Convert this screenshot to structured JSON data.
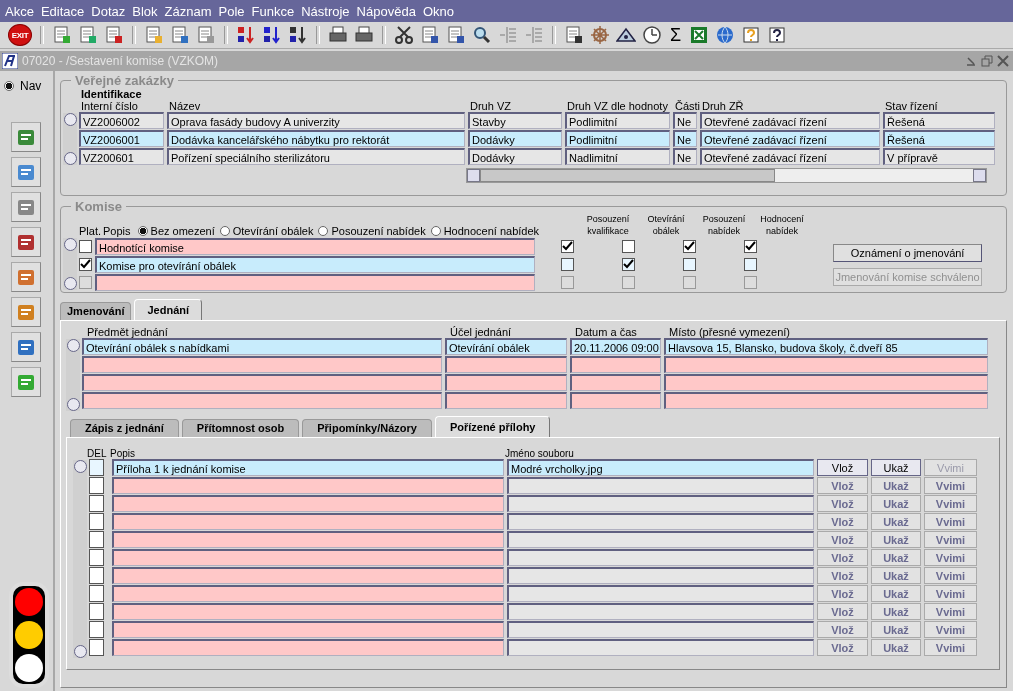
{
  "menu": [
    {
      "label": "Akce"
    },
    {
      "label": "Editace"
    },
    {
      "label": "Dotaz"
    },
    {
      "label": "Blok"
    },
    {
      "label": "Záznam"
    },
    {
      "label": "Pole"
    },
    {
      "label": "Funkce"
    },
    {
      "label": "Nástroje"
    },
    {
      "label": "Nápověda"
    },
    {
      "label": "Okno"
    }
  ],
  "toolbar": {
    "exit_label": "EXIT",
    "sum_glyph": "Σ"
  },
  "window": {
    "title": "07020 - /Sestavení komise (VZKOM)"
  },
  "nav": {
    "label": "Nav",
    "selected": true
  },
  "zakazky": {
    "title": "Veřejné zakázky",
    "group_label": "Identifikace",
    "columns": [
      "Interní číslo",
      "Název",
      "Druh VZ",
      "Druh VZ dle hodnoty",
      "Části",
      "Druh ZŘ",
      "Stav řízení"
    ],
    "rows": [
      {
        "selected": false,
        "cells": [
          "VZ2006002",
          "Oprava fasády budovy A univerzity",
          "Stavby",
          "Podlimitní",
          "Ne",
          "Otevřené zadávací řízení",
          "Řešená"
        ]
      },
      {
        "selected": true,
        "cells": [
          "VZ2006001",
          "Dodávka kancelářského nábytku pro rektorát",
          "Dodávky",
          "Podlimitní",
          "Ne",
          "Otevřené zadávací řízení",
          "Řešená"
        ]
      },
      {
        "selected": false,
        "cells": [
          "VZ200601",
          "Pořízení speciálního sterilizátoru",
          "Dodávky",
          "Nadlimitní",
          "Ne",
          "Otevřené zadávací řízení",
          "V přípravě"
        ]
      }
    ]
  },
  "komise": {
    "title": "Komise",
    "plat_label": "Plat.",
    "popis_label": "Popis",
    "filters": [
      {
        "label": "Bez omezení",
        "selected": true
      },
      {
        "label": "Otevírání obálek",
        "selected": false
      },
      {
        "label": "Posouzení nabídek",
        "selected": false
      },
      {
        "label": "Hodnocení nabídek",
        "selected": false
      }
    ],
    "flag_columns": [
      "Posouzení kvalifikace",
      "Otevírání obálek",
      "Posouzení nabídek",
      "Hodnocení nabídek"
    ],
    "rows": [
      {
        "selected": false,
        "disabled": false,
        "checked": false,
        "popis": "Hodnotící komise",
        "flags": [
          true,
          false,
          true,
          true
        ]
      },
      {
        "selected": true,
        "disabled": false,
        "checked": true,
        "popis": "Komise pro otevírání obálek",
        "flags": [
          false,
          true,
          false,
          false
        ]
      },
      {
        "selected": false,
        "disabled": true,
        "checked": false,
        "flags": [
          false,
          false,
          false,
          false
        ]
      }
    ],
    "buttons": [
      {
        "label": "Oznámení o jmenování",
        "disabled": false
      },
      {
        "label": "Jmenování komise schváleno",
        "disabled": true
      }
    ]
  },
  "tabs": [
    {
      "label": "Jmenování",
      "selected": false
    },
    {
      "label": "Jednání",
      "selected": true
    }
  ],
  "jednani": {
    "columns": [
      "Předmět jednání",
      "Účel jednání",
      "Datum a čas",
      "Místo (přesné vymezení)"
    ],
    "rows": [
      {
        "selected": true,
        "cells": [
          "Otevírání obálek s nabídkami",
          "Otevírání obálek",
          "20.11.2006 09:00",
          "Hlavsova 15, Blansko, budova školy, č.dveří 85"
        ]
      },
      {
        "selected": false
      },
      {
        "selected": false
      },
      {
        "selected": false
      }
    ]
  },
  "subtabs": [
    {
      "label": "Zápis z jednání",
      "selected": false
    },
    {
      "label": "Přítomnost osob",
      "selected": false
    },
    {
      "label": "Připomínky/Názory",
      "selected": false
    },
    {
      "label": "Pořízené přílohy",
      "selected": true
    }
  ],
  "prilohy": {
    "columns": [
      "DEL",
      "Popis",
      "Jméno souboru"
    ],
    "rows": [
      {
        "selected": true,
        "del": false,
        "popis": "Příloha 1 k jednání komise",
        "file": "Modré vrcholky.jpg",
        "buttons": [
          {
            "label": "Vlož",
            "disabled": false
          },
          {
            "label": "Ukaž",
            "disabled": false
          },
          {
            "label": "Vvimi",
            "disabled": true
          }
        ]
      },
      {
        "selected": false,
        "del": false,
        "buttons": [
          {
            "label": "Vlož",
            "disabled": true
          },
          {
            "label": "Ukaž",
            "disabled": true
          },
          {
            "label": "Vvimi",
            "disabled": true
          }
        ]
      },
      {
        "selected": false,
        "del": false,
        "buttons": [
          {
            "label": "Vlož",
            "disabled": true
          },
          {
            "label": "Ukaž",
            "disabled": true
          },
          {
            "label": "Vvimi",
            "disabled": true
          }
        ]
      },
      {
        "selected": false,
        "del": false,
        "buttons": [
          {
            "label": "Vlož",
            "disabled": true
          },
          {
            "label": "Ukaž",
            "disabled": true
          },
          {
            "label": "Vvimi",
            "disabled": true
          }
        ]
      },
      {
        "selected": false,
        "del": false,
        "buttons": [
          {
            "label": "Vlož",
            "disabled": true
          },
          {
            "label": "Ukaž",
            "disabled": true
          },
          {
            "label": "Vvimi",
            "disabled": true
          }
        ]
      },
      {
        "selected": false,
        "del": false,
        "buttons": [
          {
            "label": "Vlož",
            "disabled": true
          },
          {
            "label": "Ukaž",
            "disabled": true
          },
          {
            "label": "Vvimi",
            "disabled": true
          }
        ]
      },
      {
        "selected": false,
        "del": false,
        "buttons": [
          {
            "label": "Vlož",
            "disabled": true
          },
          {
            "label": "Ukaž",
            "disabled": true
          },
          {
            "label": "Vvimi",
            "disabled": true
          }
        ]
      },
      {
        "selected": false,
        "del": false,
        "buttons": [
          {
            "label": "Vlož",
            "disabled": true
          },
          {
            "label": "Ukaž",
            "disabled": true
          },
          {
            "label": "Vvimi",
            "disabled": true
          }
        ]
      },
      {
        "selected": false,
        "del": false,
        "buttons": [
          {
            "label": "Vlož",
            "disabled": true
          },
          {
            "label": "Ukaž",
            "disabled": true
          },
          {
            "label": "Vvimi",
            "disabled": true
          }
        ]
      },
      {
        "selected": false,
        "del": false,
        "buttons": [
          {
            "label": "Vlož",
            "disabled": true
          },
          {
            "label": "Ukaž",
            "disabled": true
          },
          {
            "label": "Vvimi",
            "disabled": true
          }
        ]
      },
      {
        "selected": false,
        "del": false,
        "buttons": [
          {
            "label": "Vlož",
            "disabled": true
          },
          {
            "label": "Ukaž",
            "disabled": true
          },
          {
            "label": "Vvimi",
            "disabled": true
          }
        ]
      }
    ]
  }
}
